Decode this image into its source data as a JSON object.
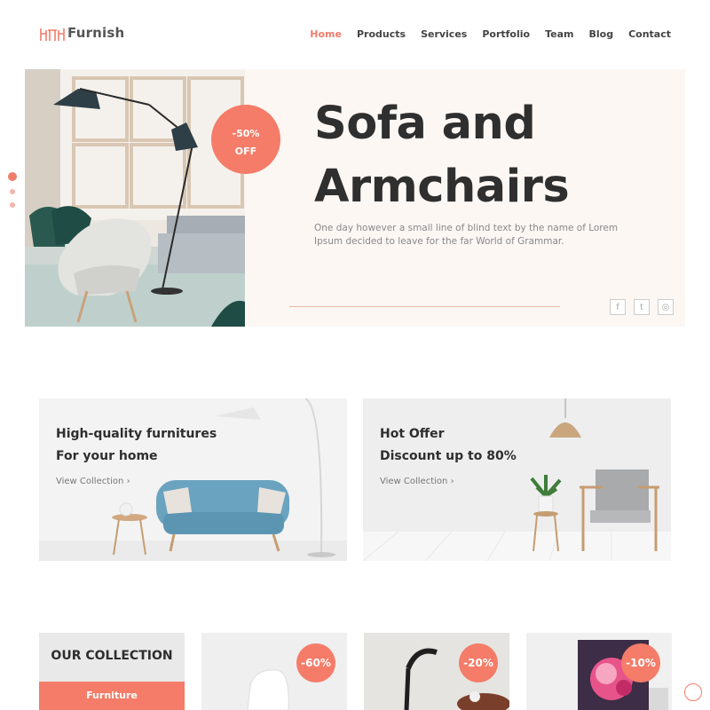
{
  "brand": {
    "name": "Furnish",
    "icon": "chair-table-logo-icon",
    "accent": "#f47c68"
  },
  "nav": {
    "items": [
      "Home",
      "Products",
      "Services",
      "Portfolio",
      "Team",
      "Blog",
      "Contact"
    ],
    "active": "Home"
  },
  "hero": {
    "badge_line1": "-50%",
    "badge_line2": "OFF",
    "title_line1_word1": "Sofa",
    "title_line1_word2": "and",
    "title_line2": "Armchairs",
    "description": "One day however a small line of blind text by the name of Lorem Ipsum decided to leave for the far World of Grammar.",
    "socials": [
      "facebook-icon",
      "twitter-icon",
      "instagram-icon"
    ],
    "social_glyphs": [
      "f",
      "t",
      "◎"
    ],
    "slide_count": 3,
    "active_slide": 1
  },
  "promos": [
    {
      "title_line1": "High-quality furnitures",
      "title_line2": "For your home",
      "link": "View Collection"
    },
    {
      "title_line1": "Hot Offer",
      "title_line2": "Discount up to 80%",
      "link": "View Collection"
    }
  ],
  "collection": {
    "title": "OUR COLLECTION",
    "active_tab": "Furniture",
    "products": [
      {
        "badge": "-60%"
      },
      {
        "badge": "-20%"
      },
      {
        "badge": "-10%"
      }
    ]
  }
}
